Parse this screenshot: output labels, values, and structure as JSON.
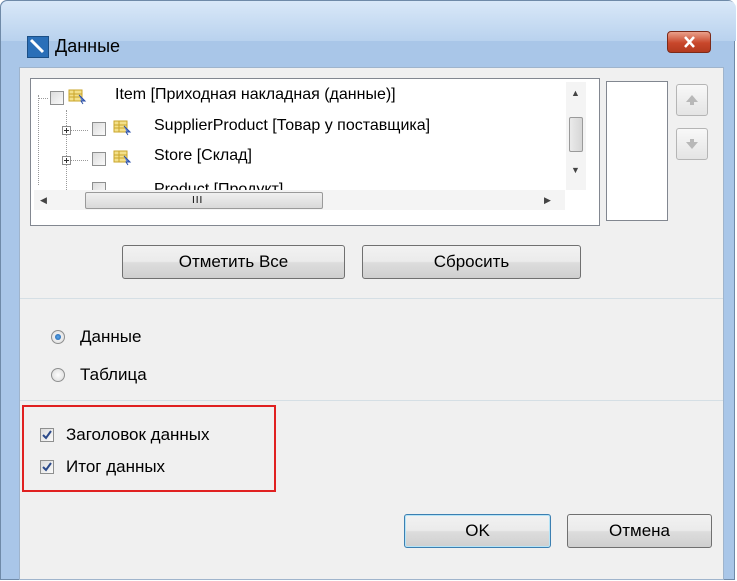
{
  "window": {
    "title": "Данные",
    "icon": "data-source-icon",
    "close_icon": "close-icon"
  },
  "tree": {
    "nodes": [
      {
        "label": "Item [Приходная накладная (данные)]",
        "checked": false,
        "expandable": false
      },
      {
        "label": "SupplierProduct [Товар у поставщика]",
        "checked": false,
        "expandable": true
      },
      {
        "label": "Store [Склад]",
        "checked": false,
        "expandable": true
      },
      {
        "label": "Product [Продукт]",
        "checked": false,
        "expandable": true
      }
    ],
    "hscroll_grip": "III"
  },
  "side_buttons": {
    "up_icon": "move-up-icon",
    "down_icon": "move-down-icon"
  },
  "buttons": {
    "select_all": "Отметить Все",
    "reset": "Сбросить",
    "ok": "OK",
    "cancel": "Отмена"
  },
  "mode": {
    "options": [
      "Данные",
      "Таблица"
    ],
    "selected": "Данные"
  },
  "options": {
    "header": {
      "label": "Заголовок данных",
      "checked": true
    },
    "footer": {
      "label": "Итог данных",
      "checked": true
    }
  },
  "colors": {
    "highlight": "#e02020",
    "accent": "#3c7fb1"
  }
}
